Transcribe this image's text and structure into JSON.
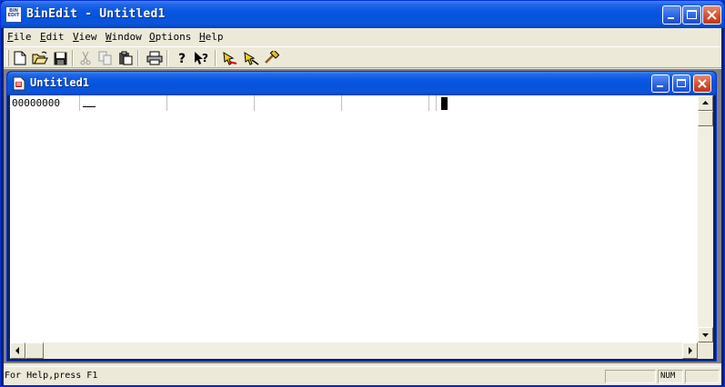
{
  "app": {
    "title": "BinEdit - Untitled1",
    "icon_text": "BIN EDIT"
  },
  "menu": [
    {
      "label": "File",
      "mnemonic": "F",
      "rest": "ile"
    },
    {
      "label": "Edit",
      "mnemonic": "E",
      "rest": "dit"
    },
    {
      "label": "View",
      "mnemonic": "V",
      "rest": "iew"
    },
    {
      "label": "Window",
      "mnemonic": "W",
      "rest": "indow"
    },
    {
      "label": "Options",
      "mnemonic": "O",
      "rest": "ptions"
    },
    {
      "label": "Help",
      "mnemonic": "H",
      "rest": "elp"
    }
  ],
  "toolbar": {
    "buttons": [
      "new-icon",
      "open-icon",
      "save-icon",
      "cut-icon",
      "copy-icon",
      "paste-icon",
      "print-icon",
      "help-icon",
      "context-help-icon",
      "tool-arrow-icon",
      "tool-arrow-edit-icon",
      "tool-hammer-icon"
    ]
  },
  "document": {
    "title": "Untitled1",
    "offset": "00000000"
  },
  "statusbar": {
    "help_text": "For Help,press F1",
    "num": "NUM"
  },
  "colors": {
    "title_blue": "#0a58e4",
    "close_red": "#d6502f",
    "face": "#ece9d8",
    "mdi_bg": "#808080"
  }
}
